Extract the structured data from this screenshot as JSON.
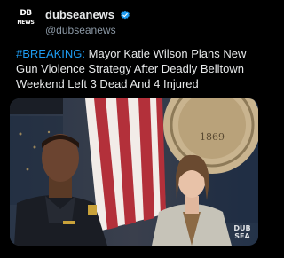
{
  "account": {
    "logo_line1": "DB",
    "logo_line2": "NEWS",
    "display_name": "dubseanews",
    "handle": "@dubseanews",
    "verified_icon": "verified-badge-icon",
    "verified_color": "#1d9bf0"
  },
  "tweet": {
    "hashtag": "#BREAKING:",
    "body": " Mayor Katie Wilson Plans New Gun Violence Strategy After Deadly Belltown Weekend Left 3 Dead And 4 Injured"
  },
  "media": {
    "seal_year": "1869",
    "watermark_line1": "DUB",
    "watermark_line2": "SEA"
  }
}
